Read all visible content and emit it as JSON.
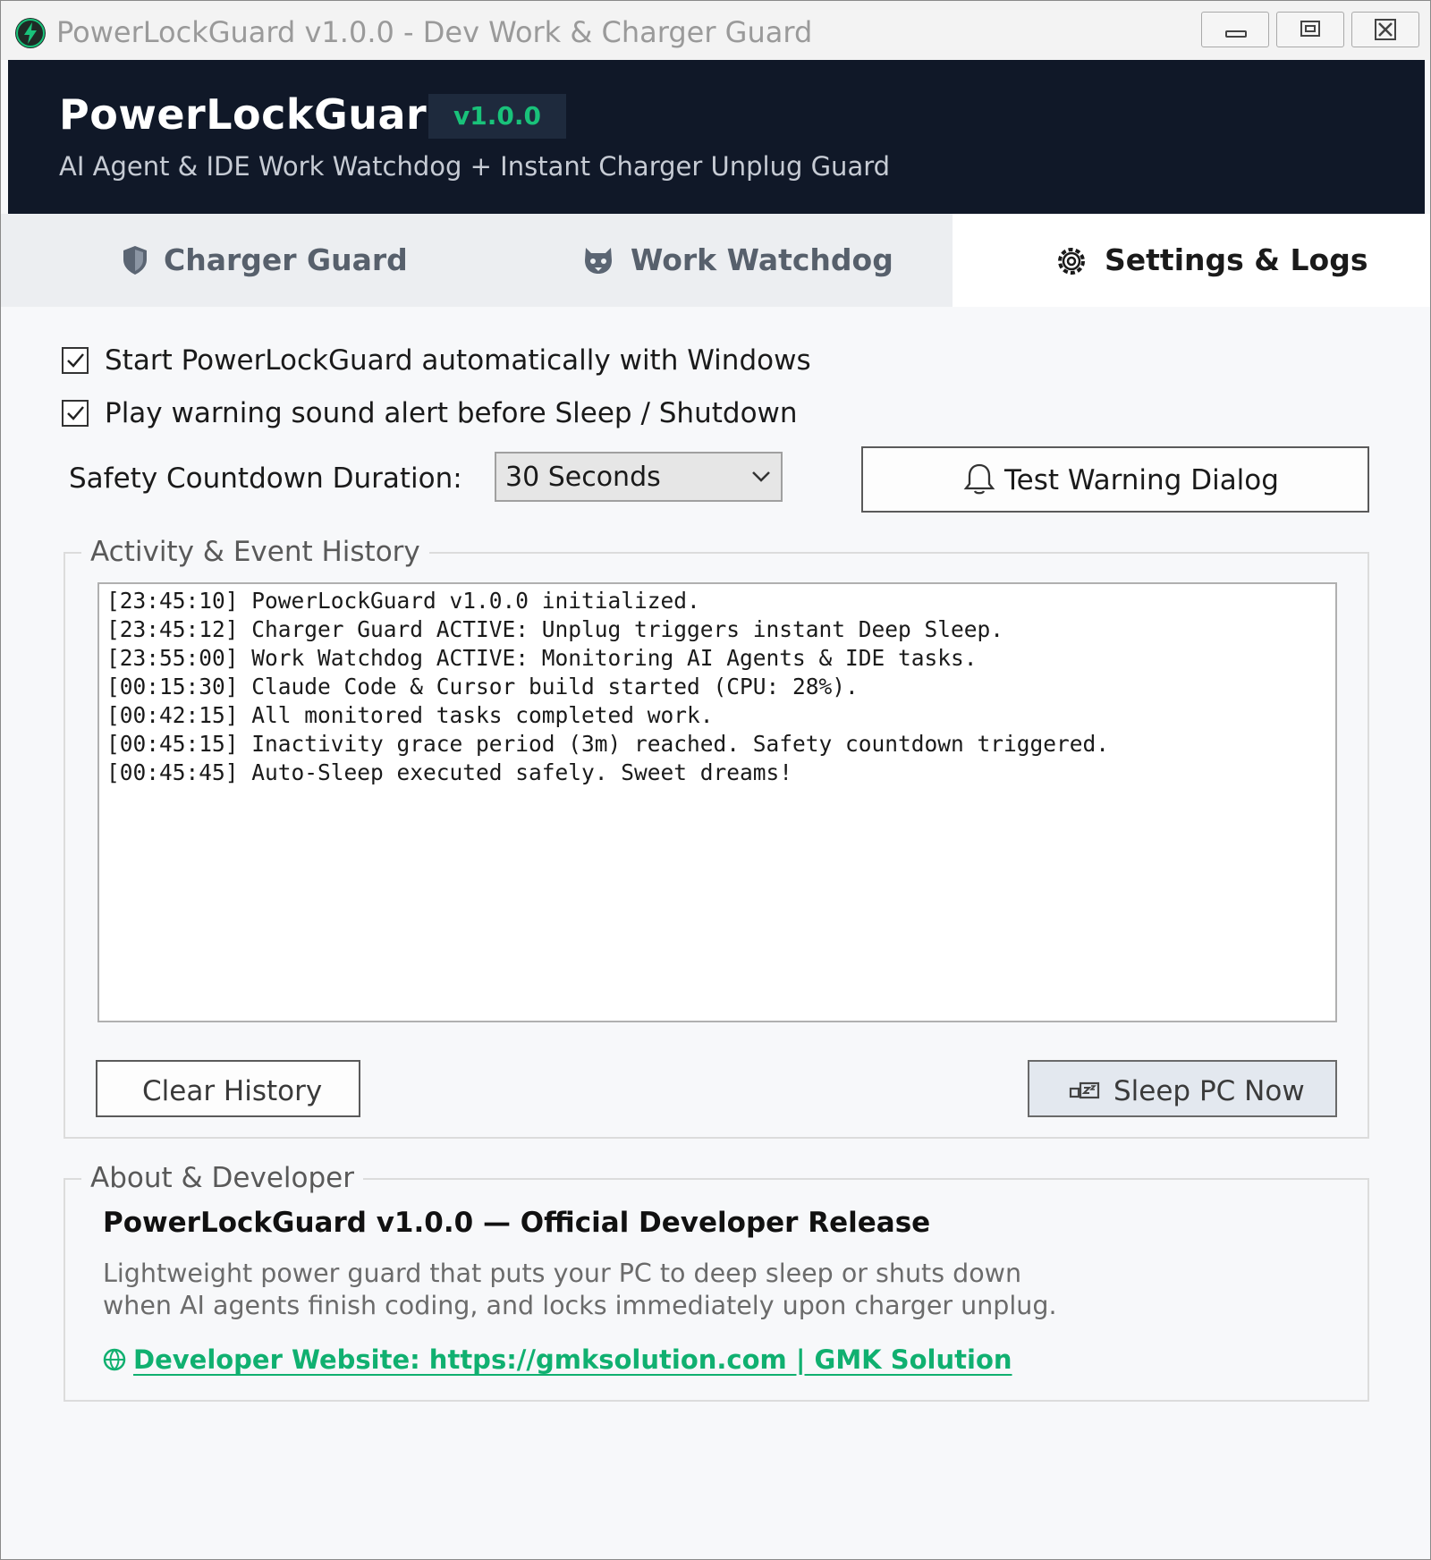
{
  "window": {
    "title": "PowerLockGuard v1.0.0 - Dev Work & Charger Guard"
  },
  "header": {
    "brand": "PowerLockGuard",
    "version_badge": "v1.0.0",
    "tagline": "AI Agent & IDE Work Watchdog + Instant Charger Unplug Guard"
  },
  "tabs": [
    {
      "label": "Charger Guard",
      "icon": "shield-icon",
      "active": false
    },
    {
      "label": "Work Watchdog",
      "icon": "dog-icon",
      "active": false
    },
    {
      "label": "Settings & Logs",
      "icon": "gear-icon",
      "active": true
    }
  ],
  "settings": {
    "autostart_label": "Start PowerLockGuard automatically with Windows",
    "autostart_checked": true,
    "sound_label": "Play warning sound alert before Sleep / Shutdown",
    "sound_checked": true,
    "countdown_label": "Safety Countdown Duration:",
    "countdown_value": "30 Seconds",
    "test_button": "Test Warning Dialog"
  },
  "activity": {
    "title": "Activity & Event History",
    "log": [
      "[23:45:10] PowerLockGuard v1.0.0 initialized.",
      "[23:45:12] Charger Guard ACTIVE: Unplug triggers instant Deep Sleep.",
      "[23:55:00] Work Watchdog ACTIVE: Monitoring AI Agents & IDE tasks.",
      "[00:15:30] Claude Code & Cursor build started (CPU: 28%).",
      "[00:42:15] All monitored tasks completed work.",
      "[00:45:15] Inactivity grace period (3m) reached. Safety countdown triggered.",
      "[00:45:45] Auto-Sleep executed safely. Sweet dreams!"
    ],
    "clear_button": "Clear History",
    "sleep_button": "Sleep PC Now"
  },
  "about": {
    "title": "About & Developer",
    "heading": "PowerLockGuard v1.0.0 — Official Developer Release",
    "desc_line1": "Lightweight power guard that puts your PC to deep sleep or shuts down",
    "desc_line2": "when AI agents finish coding, and locks immediately upon charger unplug.",
    "link": "Developer Website: https://gmksolution.com  |  GMK Solution"
  },
  "colors": {
    "header_bg": "#101828",
    "accent_green": "#19c27a",
    "link_green": "#10b070",
    "tab_active_bg": "#ffffff"
  }
}
